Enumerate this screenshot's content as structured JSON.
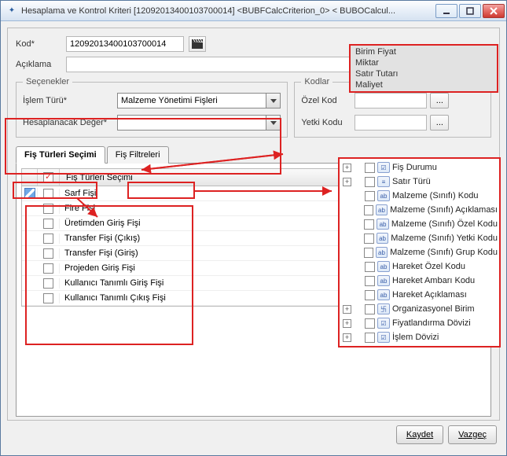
{
  "titlebar": "Hesaplama ve Kontrol Kriteri [12092013400103700014] <BUBFCalcCriterion_0>  < BUBOCalcul...",
  "form": {
    "kod_label": "Kod*",
    "kod_value": "12092013400103700014",
    "aciklama_label": "Açıklama",
    "aciklama_value": ""
  },
  "fieldsets": {
    "left_legend": "Seçenekler",
    "right_legend": "Kodlar",
    "islem_turu_label": "İşlem Türü*",
    "islem_turu_value": "Malzeme Yönetimi Fişleri",
    "hesap_label": "Hesaplanacak Değer*",
    "hesap_value": "",
    "ozel_kod_label": "Özel Kod",
    "ozel_kod_value": "",
    "yetki_kodu_label": "Yetki Kodu",
    "yetki_kodu_value": ""
  },
  "tabs": {
    "tab1": "Fiş Türleri Seçimi",
    "tab2": "Fiş Filtreleri"
  },
  "grid": {
    "header": "Fiş Türleri Seçimi",
    "rows": [
      "Sarf Fişi",
      "Fire Fişi",
      "Üretimden Giriş Fişi",
      "Transfer Fişi (Çıkış)",
      "Transfer Fişi (Giriş)",
      "Projeden Giriş Fişi",
      "Kullanıcı Tanımlı Giriş Fişi",
      "Kullanıcı Tanımlı Çıkış Fişi"
    ]
  },
  "dropdown_options": [
    "Birim Fiyat",
    "Miktar",
    "Satır Tutarı",
    "Maliyet"
  ],
  "tree": [
    {
      "exp": "+",
      "ico": "☑",
      "label": "Fiş Durumu"
    },
    {
      "exp": "+",
      "ico": "≡",
      "label": "Satır Türü"
    },
    {
      "exp": "",
      "ico": "ab",
      "label": "Malzeme (Sınıfı) Kodu"
    },
    {
      "exp": "",
      "ico": "ab",
      "label": "Malzeme (Sınıfı) Açıklaması"
    },
    {
      "exp": "",
      "ico": "ab",
      "label": "Malzeme (Sınıfı) Özel Kodu"
    },
    {
      "exp": "",
      "ico": "ab",
      "label": "Malzeme (Sınıfı) Yetki Kodu"
    },
    {
      "exp": "",
      "ico": "ab",
      "label": "Malzeme (Sınıfı) Grup Kodu"
    },
    {
      "exp": "",
      "ico": "ab",
      "label": "Hareket Özel Kodu"
    },
    {
      "exp": "",
      "ico": "ab",
      "label": "Hareket Ambarı Kodu"
    },
    {
      "exp": "",
      "ico": "ab",
      "label": "Hareket Açıklaması"
    },
    {
      "exp": "+",
      "ico": "卐",
      "label": "Organizasyonel Birim"
    },
    {
      "exp": "+",
      "ico": "☑",
      "label": "Fiyatlandırma Dövizi"
    },
    {
      "exp": "+",
      "ico": "☑",
      "label": "İşlem Dövizi"
    }
  ],
  "buttons": {
    "save": "Kaydet",
    "cancel": "Vazgeç",
    "dots": "..."
  }
}
